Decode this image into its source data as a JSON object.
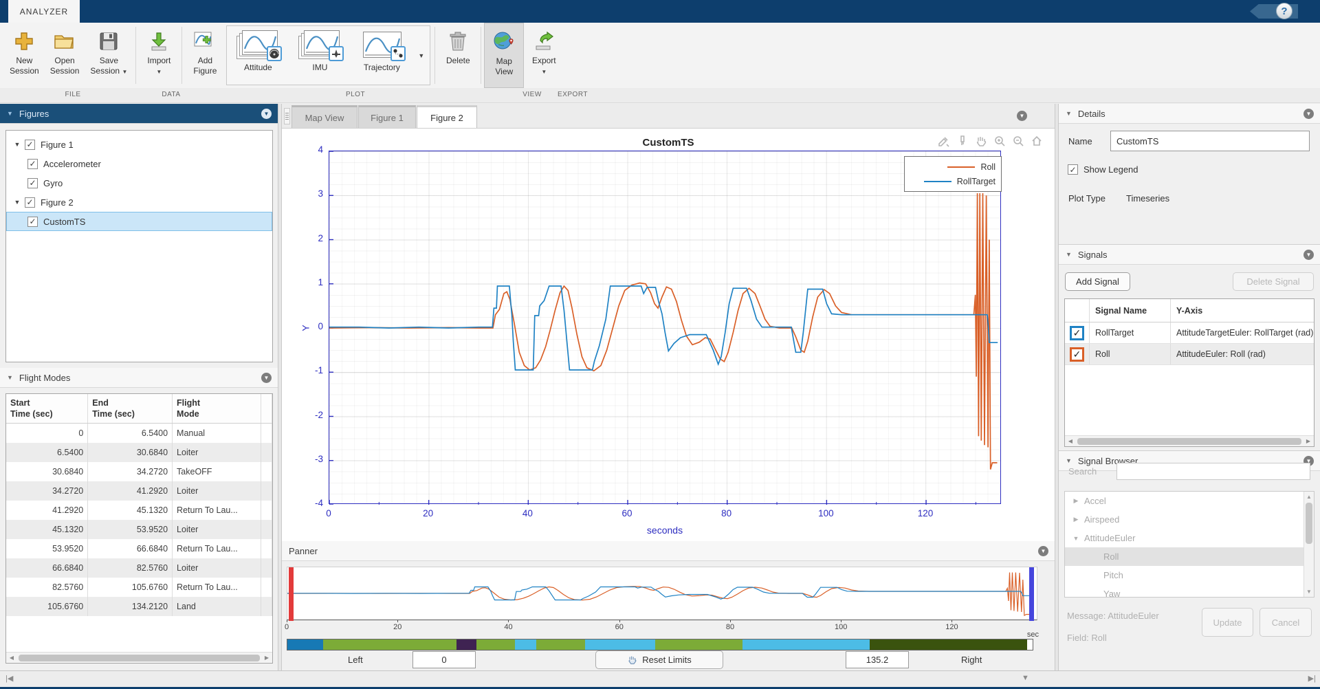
{
  "titlebar": {
    "app_tab": "ANALYZER",
    "help": "?"
  },
  "toolbar": {
    "sections": [
      "FILE",
      "DATA",
      "PLOT",
      "VIEW",
      "EXPORT"
    ],
    "new_session": [
      "New",
      "Session"
    ],
    "open_session": [
      "Open",
      "Session"
    ],
    "save_session": [
      "Save",
      "Session"
    ],
    "import": "Import",
    "add_figure": [
      "Add",
      "Figure"
    ],
    "gallery": [
      "Attitude",
      "IMU",
      "Trajectory"
    ],
    "delete": "Delete",
    "map_view": [
      "Map",
      "View"
    ],
    "export": "Export"
  },
  "left": {
    "figures": {
      "title": "Figures",
      "tree": [
        {
          "label": "Figure 1",
          "checked": true,
          "expanded": true,
          "parent": true
        },
        {
          "label": "Accelerometer",
          "checked": true,
          "child": true
        },
        {
          "label": "Gyro",
          "checked": true,
          "child": true
        },
        {
          "label": "Figure 2",
          "checked": true,
          "expanded": true,
          "parent": true
        },
        {
          "label": "CustomTS",
          "checked": true,
          "child": true,
          "selected": true
        }
      ]
    },
    "flight_modes": {
      "title": "Flight Modes",
      "columns": [
        [
          "Start",
          "Time (sec)"
        ],
        [
          "End",
          "Time (sec)"
        ],
        [
          "Flight",
          "Mode"
        ]
      ],
      "rows": [
        {
          "start": "0",
          "end": "6.5400",
          "mode": "Manual",
          "color": "#1779b5"
        },
        {
          "start": "6.5400",
          "end": "30.6840",
          "mode": "Loiter",
          "color": "#7cab37"
        },
        {
          "start": "30.6840",
          "end": "34.2720",
          "mode": "TakeOFF",
          "color": "#3f2352"
        },
        {
          "start": "34.2720",
          "end": "41.2920",
          "mode": "Loiter",
          "color": "#7cab37"
        },
        {
          "start": "41.2920",
          "end": "45.1320",
          "mode": "Return To Lau...",
          "color": "#4cbce6"
        },
        {
          "start": "45.1320",
          "end": "53.9520",
          "mode": "Loiter",
          "color": "#7cab37"
        },
        {
          "start": "53.9520",
          "end": "66.6840",
          "mode": "Return To Lau...",
          "color": "#4cbce6"
        },
        {
          "start": "66.6840",
          "end": "82.5760",
          "mode": "Loiter",
          "color": "#7cab37"
        },
        {
          "start": "82.5760",
          "end": "105.6760",
          "mode": "Return To Lau...",
          "color": "#4cbce6"
        },
        {
          "start": "105.6760",
          "end": "134.2120",
          "mode": "Land",
          "color": "#3a530e"
        }
      ]
    }
  },
  "center": {
    "tabs": [
      {
        "label": "Map View",
        "active": false
      },
      {
        "label": "Figure 1",
        "active": false
      },
      {
        "label": "Figure 2",
        "active": true
      }
    ],
    "panner": {
      "title": "Panner",
      "left_label": "Left",
      "left_value": "0",
      "reset_label": "Reset Limits",
      "right_value": "135.2",
      "right_label": "Right",
      "unit": "sec",
      "ticks": [
        0,
        20,
        40,
        60,
        80,
        100,
        120
      ]
    }
  },
  "right": {
    "details": {
      "title": "Details",
      "name_label": "Name",
      "name_value": "CustomTS",
      "show_legend_label": "Show Legend",
      "show_legend_checked": true,
      "plot_type_label": "Plot Type",
      "plot_type_value": "Timeseries"
    },
    "signals": {
      "title": "Signals",
      "add_button": "Add Signal",
      "delete_button": "Delete Signal",
      "columns": [
        "Signal Name",
        "Y-Axis"
      ],
      "rows": [
        {
          "checked": true,
          "check_color": "#1f82c4",
          "name": "RollTarget",
          "yaxis": "AttitudeTargetEuler: RollTarget (rad)"
        },
        {
          "checked": true,
          "check_color": "#d95f27",
          "name": "Roll",
          "yaxis": "AttitudeEuler: Roll (rad)"
        }
      ]
    },
    "signal_browser": {
      "title": "Signal Browser",
      "search_label": "Search",
      "items": [
        {
          "label": "Accel",
          "depth": 0,
          "expanded": false
        },
        {
          "label": "Airspeed",
          "depth": 0,
          "expanded": false
        },
        {
          "label": "AttitudeEuler",
          "depth": 0,
          "expanded": true
        },
        {
          "label": "Roll",
          "depth": 1,
          "selected": true
        },
        {
          "label": "Pitch",
          "depth": 1
        },
        {
          "label": "Yaw",
          "depth": 1
        }
      ],
      "message": "Message: AttitudeEuler",
      "field": "Field: Roll",
      "update_button": "Update",
      "cancel_button": "Cancel"
    }
  },
  "chart_data": {
    "type": "line",
    "title": "CustomTS",
    "xlabel": "seconds",
    "ylabel": "Y",
    "xlim": [
      0,
      135.2
    ],
    "ylim": [
      -4,
      4
    ],
    "x_ticks": [
      0,
      20,
      40,
      60,
      80,
      100,
      120
    ],
    "x_minor_ticks": [
      10,
      30,
      50,
      70,
      90,
      110,
      130
    ],
    "y_ticks": [
      -4,
      -3,
      -2,
      -1,
      0,
      1,
      2,
      3,
      4
    ],
    "grid": true,
    "legend": {
      "position": "top-right",
      "entries": [
        "Roll",
        "RollTarget"
      ]
    },
    "series": [
      {
        "name": "Roll",
        "color": "#d95f27",
        "points": [
          [
            0,
            0
          ],
          [
            8,
            0.01
          ],
          [
            16,
            0
          ],
          [
            24,
            0.01
          ],
          [
            30,
            0
          ],
          [
            32.9,
            0
          ],
          [
            33.4,
            0.3
          ],
          [
            34.2,
            0.42
          ],
          [
            35.1,
            0.78
          ],
          [
            35.7,
            0.82
          ],
          [
            36.3,
            0.65
          ],
          [
            37.2,
            0.1
          ],
          [
            38.2,
            -0.55
          ],
          [
            39.2,
            -0.85
          ],
          [
            40.3,
            -0.95
          ],
          [
            41.5,
            -0.9
          ],
          [
            42.5,
            -0.72
          ],
          [
            43.5,
            -0.42
          ],
          [
            44.4,
            -0.05
          ],
          [
            45.4,
            0.4
          ],
          [
            46.4,
            0.8
          ],
          [
            47.2,
            0.95
          ],
          [
            48,
            0.85
          ],
          [
            48.8,
            0.45
          ],
          [
            49.8,
            -0.15
          ],
          [
            50.8,
            -0.65
          ],
          [
            51.8,
            -0.9
          ],
          [
            53.2,
            -0.97
          ],
          [
            54.6,
            -0.85
          ],
          [
            55.8,
            -0.5
          ],
          [
            57,
            0
          ],
          [
            58.2,
            0.5
          ],
          [
            59.4,
            0.85
          ],
          [
            60.8,
            0.97
          ],
          [
            62.4,
            1.02
          ],
          [
            63.6,
            1
          ],
          [
            64.6,
            0.8
          ],
          [
            65.4,
            0.55
          ],
          [
            66.1,
            0.45
          ],
          [
            66.9,
            0.7
          ],
          [
            67.8,
            0.93
          ],
          [
            68.8,
            0.88
          ],
          [
            69.8,
            0.6
          ],
          [
            70.8,
            0.18
          ],
          [
            71.8,
            -0.18
          ],
          [
            73,
            -0.38
          ],
          [
            74.4,
            -0.32
          ],
          [
            75.6,
            -0.22
          ],
          [
            76.6,
            -0.25
          ],
          [
            77.6,
            -0.48
          ],
          [
            78.6,
            -0.7
          ],
          [
            79.4,
            -0.76
          ],
          [
            80.2,
            -0.55
          ],
          [
            81.2,
            -0.1
          ],
          [
            82.2,
            0.4
          ],
          [
            83.2,
            0.78
          ],
          [
            84.4,
            0.9
          ],
          [
            85.6,
            0.78
          ],
          [
            86.6,
            0.5
          ],
          [
            87.6,
            0.2
          ],
          [
            88.6,
            0.04
          ],
          [
            90.5,
            0
          ],
          [
            93,
            0
          ],
          [
            93.8,
            -0.2
          ],
          [
            94.8,
            -0.5
          ],
          [
            95.5,
            -0.55
          ],
          [
            96.2,
            -0.3
          ],
          [
            97.2,
            0.25
          ],
          [
            98.2,
            0.7
          ],
          [
            99.5,
            0.87
          ],
          [
            100.6,
            0.78
          ],
          [
            101.8,
            0.5
          ],
          [
            103,
            0.35
          ],
          [
            105,
            0.3
          ],
          [
            126,
            0.3
          ],
          [
            129.6,
            0.3
          ],
          [
            129.9,
            0.75
          ],
          [
            130.1,
            -1.1
          ],
          [
            130.3,
            3.05
          ],
          [
            130.55,
            -2.45
          ],
          [
            130.8,
            3.05
          ],
          [
            131.1,
            -2.55
          ],
          [
            131.4,
            3.05
          ],
          [
            131.75,
            -2.65
          ],
          [
            132.1,
            3
          ],
          [
            132.45,
            -2.7
          ],
          [
            132.7,
            2
          ],
          [
            132.95,
            -3.2
          ],
          [
            133.3,
            -3.05
          ],
          [
            134.3,
            -3.05
          ]
        ]
      },
      {
        "name": "RollTarget",
        "color": "#1f82c4",
        "points": [
          [
            0,
            0.02
          ],
          [
            6,
            0.02
          ],
          [
            12,
            0
          ],
          [
            18,
            0.02
          ],
          [
            24,
            0
          ],
          [
            30,
            0.02
          ],
          [
            32.8,
            0.02
          ],
          [
            33.1,
            0.45
          ],
          [
            33.6,
            0.45
          ],
          [
            33.8,
            0.95
          ],
          [
            36.2,
            0.95
          ],
          [
            36.5,
            0.55
          ],
          [
            36.7,
            0.3
          ],
          [
            37,
            -0.3
          ],
          [
            37.4,
            -0.95
          ],
          [
            41,
            -0.95
          ],
          [
            41.3,
            0.28
          ],
          [
            42.1,
            0.28
          ],
          [
            42.3,
            0.5
          ],
          [
            43.2,
            0.62
          ],
          [
            44.2,
            0.95
          ],
          [
            46.6,
            0.95
          ],
          [
            47.2,
            0.4
          ],
          [
            48.3,
            -0.95
          ],
          [
            52.9,
            -0.95
          ],
          [
            53.3,
            -0.75
          ],
          [
            54.3,
            -0.4
          ],
          [
            55.6,
            0.2
          ],
          [
            56.5,
            0.95
          ],
          [
            62.7,
            0.95
          ],
          [
            63.2,
            0.78
          ],
          [
            63.9,
            0.92
          ],
          [
            65.6,
            0.92
          ],
          [
            66.2,
            0.6
          ],
          [
            66.9,
            0.32
          ],
          [
            67.5,
            -0.1
          ],
          [
            68.2,
            -0.52
          ],
          [
            69.3,
            -0.35
          ],
          [
            70.6,
            -0.22
          ],
          [
            72.5,
            -0.15
          ],
          [
            75.8,
            -0.15
          ],
          [
            77.2,
            -0.5
          ],
          [
            78.2,
            -0.82
          ],
          [
            78.8,
            -0.65
          ],
          [
            79.6,
            -0.1
          ],
          [
            80.4,
            0.55
          ],
          [
            81.2,
            0.9
          ],
          [
            83.9,
            0.9
          ],
          [
            84.8,
            0.62
          ],
          [
            85.9,
            0.2
          ],
          [
            87,
            0.02
          ],
          [
            92.9,
            0.02
          ],
          [
            93.4,
            -0.3
          ],
          [
            93.8,
            -0.55
          ],
          [
            94.8,
            -0.55
          ],
          [
            95.3,
            -0.1
          ],
          [
            96.2,
            0.88
          ],
          [
            99.2,
            0.88
          ],
          [
            100,
            0.55
          ],
          [
            101,
            0.32
          ],
          [
            103,
            0.3
          ],
          [
            128,
            0.3
          ],
          [
            132.3,
            0.3
          ],
          [
            132.5,
            0.05
          ],
          [
            132.7,
            -0.33
          ],
          [
            134.4,
            -0.33
          ]
        ]
      }
    ],
    "panner_view": {
      "xlim": [
        0,
        135.2
      ],
      "handle_left_t": 0.3,
      "handle_right_t": 134.3,
      "handle_left_color": "#e23b3b",
      "handle_right_color": "#4646dd"
    }
  }
}
